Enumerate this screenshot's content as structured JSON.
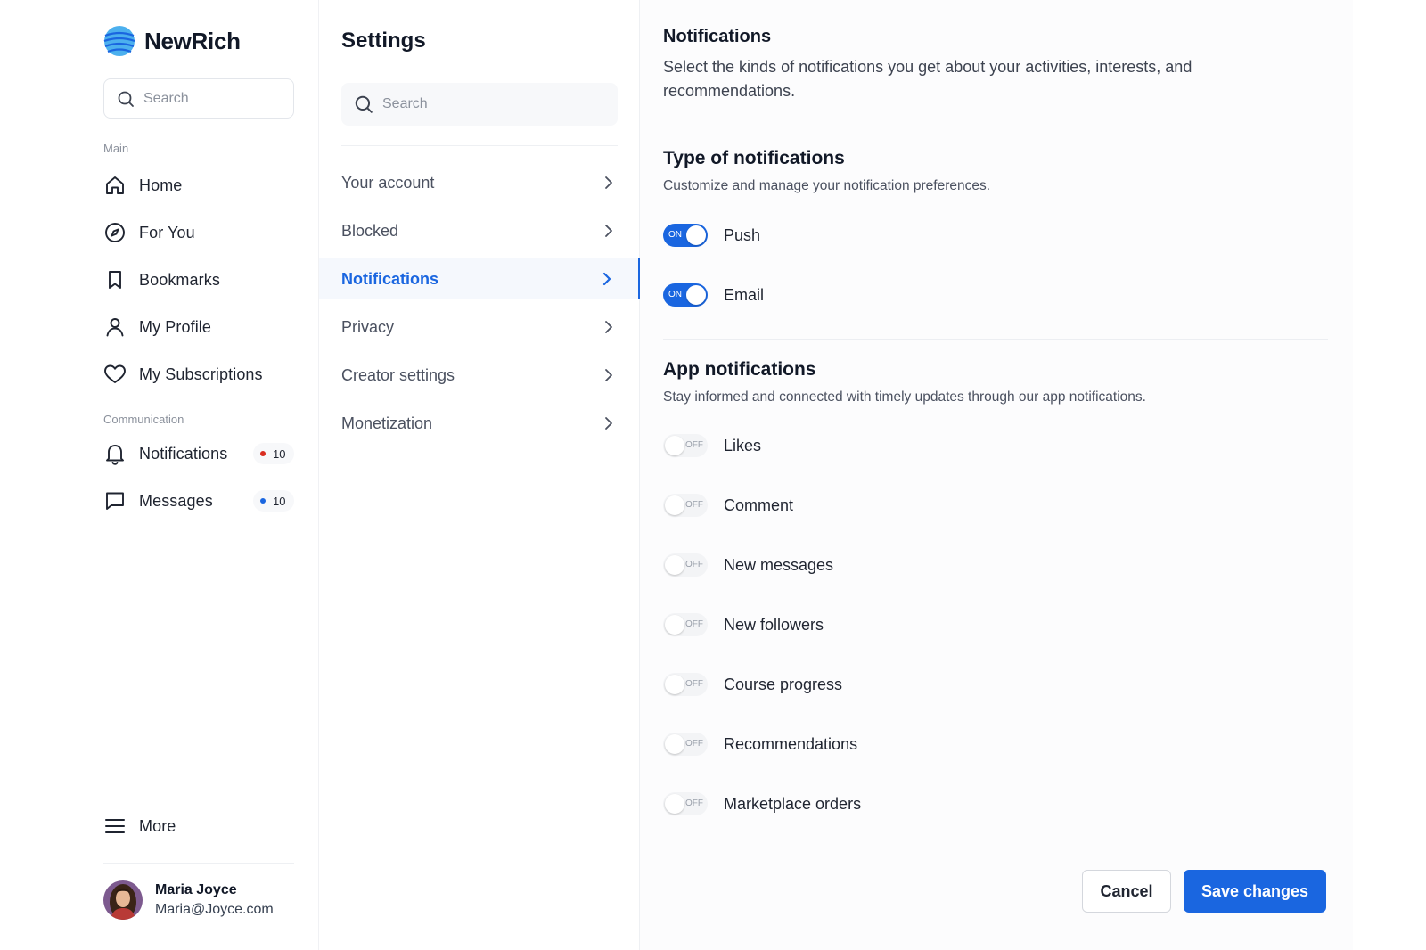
{
  "brand": {
    "name": "NewRich"
  },
  "left_search": {
    "placeholder": "Search"
  },
  "sidebar": {
    "main_label": "Main",
    "main_items": [
      {
        "label": "Home",
        "icon": "home-icon"
      },
      {
        "label": "For You",
        "icon": "compass-icon"
      },
      {
        "label": "Bookmarks",
        "icon": "bookmark-icon"
      },
      {
        "label": "My Profile",
        "icon": "user-icon"
      },
      {
        "label": "My Subscriptions",
        "icon": "heart-icon"
      }
    ],
    "communication_label": "Communication",
    "communication_items": [
      {
        "label": "Notifications",
        "icon": "bell-icon",
        "badge": "10",
        "badge_color": "#d92d20"
      },
      {
        "label": "Messages",
        "icon": "chat-icon",
        "badge": "10",
        "badge_color": "#1a66e0"
      }
    ],
    "more_label": "More"
  },
  "user": {
    "name": "Maria Joyce",
    "email": "Maria@Joyce.com"
  },
  "settings": {
    "title": "Settings",
    "search_placeholder": "Search",
    "menu": [
      {
        "label": "Your account",
        "active": false
      },
      {
        "label": "Blocked",
        "active": false
      },
      {
        "label": "Notifications",
        "active": true
      },
      {
        "label": "Privacy",
        "active": false
      },
      {
        "label": "Creator settings",
        "active": false
      },
      {
        "label": "Monetization",
        "active": false
      }
    ]
  },
  "notifications": {
    "title": "Notifications",
    "description": "Select the kinds of notifications you get about your activities, interests, and recommendations.",
    "type_section": {
      "title": "Type of notifications",
      "description": "Customize and manage your notification preferences.",
      "toggles": [
        {
          "label": "Push",
          "state": "ON"
        },
        {
          "label": "Email",
          "state": "ON"
        }
      ]
    },
    "app_section": {
      "title": "App notifications",
      "description": "Stay informed and connected with timely updates through our app notifications.",
      "toggles": [
        {
          "label": "Likes",
          "state": "OFF"
        },
        {
          "label": "Comment",
          "state": "OFF"
        },
        {
          "label": "New messages",
          "state": "OFF"
        },
        {
          "label": "New followers",
          "state": "OFF"
        },
        {
          "label": "Course progress",
          "state": "OFF"
        },
        {
          "label": "Recommendations",
          "state": "OFF"
        },
        {
          "label": "Marketplace orders",
          "state": "OFF"
        }
      ]
    },
    "cancel_label": "Cancel",
    "save_label": "Save changes"
  },
  "colors": {
    "accent": "#1a66e0",
    "text": "#1f2430",
    "muted": "#8b919c"
  }
}
